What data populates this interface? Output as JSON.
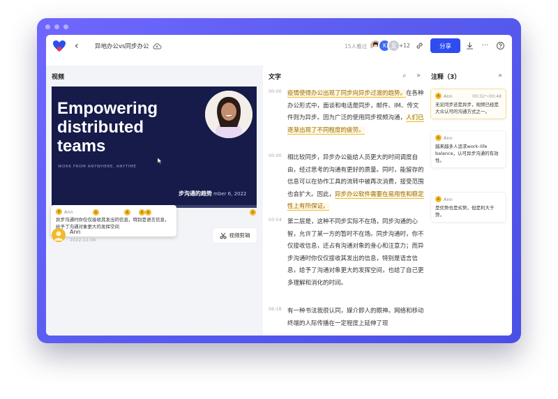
{
  "topbar": {
    "title": "异地办公vs同步办公",
    "viewers": "15人看过",
    "avatar_initial": "K",
    "viewers_more": "+12",
    "share_label": "分享"
  },
  "left": {
    "section_title": "视频",
    "video": {
      "headline": "Empowering distributed teams",
      "subline": "WORK FROM ANYWHERE, ANYTIME",
      "caption": "步沟通的趋势",
      "date": "mber 6, 2022",
      "progress": 0.21
    },
    "tooltip": {
      "user": "Ann",
      "text": "异步沟通时你仅仅接收其发出的信息，特别是语言信息，给予了沟通对象更大的发挥空间"
    },
    "marker_initial": "A",
    "user": {
      "name": "Ann",
      "date": "2022.12.06"
    },
    "clip_label": "视频剪辑"
  },
  "middle": {
    "section_title": "文字",
    "paragraphs": [
      {
        "time": "00:00",
        "html": "<span class=\"hl\">疫情使得办公出现了同步向异步过渡的趋势。</span>在各种办公形式中，面谈和电话是同步，邮件、IM、传文件则为异步。因为广泛的使用同步视频沟通，<span class=\"hl\">人们已逐渐出现了不同程度的疲劳。</span>"
      },
      {
        "time": "00:00",
        "html": "相比较同步，异步办公能给人员更大的时间调度自由，经过思考的沟通有更好的质量。同时，能留存的信息可以在协作工具的流转中被再次消费，接受范围也会扩大。因此，<span class=\"hl\">异步办公软件需要在易用性和稳定性上有所保证。</span>"
      },
      {
        "time": "03:54",
        "html": "第二层是，这种不同步实际不在场，同步沟通的心智，允许了某一方的暂时不在场。同步沟通时，你不仅接收信息，还占有沟通对象的身心和注意力；而异步沟通时你仅仅接收其发出的信息，特别是语言信息，给予了沟通对象更大的发挥空间，也给了自己更多理解和消化的时间。"
      },
      {
        "time": "06:18",
        "html": "有一种书法我很认同，媒介即人的眼神。网络和移动终端的人际传播在一定程度上延伸了现"
      }
    ]
  },
  "right": {
    "section_title": "注释（3）",
    "notes": [
      {
        "user": "Ann",
        "time": "00:32～00:48",
        "text": "无论同步还是异步，视频已经是大众认可的沟通方式之一。"
      },
      {
        "user": "Ann",
        "time": "",
        "text": "越来越多人追求work–life balance，认可异步沟通的有效性。"
      },
      {
        "user": "Ann",
        "time": "",
        "text": "是优势也是劣势，但是利大于弊。"
      }
    ]
  },
  "colors": {
    "accent": "#2e4cf0",
    "frame": "#5a5cf0",
    "highlight": "#f2b92a"
  }
}
